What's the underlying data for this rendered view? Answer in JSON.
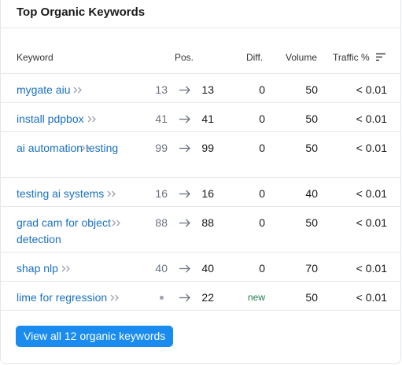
{
  "card": {
    "title": "Top Organic Keywords"
  },
  "table": {
    "headers": {
      "keyword": "Keyword",
      "pos": "Pos.",
      "diff": "Diff.",
      "volume": "Volume",
      "traffic": "Traffic %"
    },
    "rows": [
      {
        "keyword": "mygate aiu",
        "prev_pos": "13",
        "pos": "13",
        "diff": "0",
        "volume": "50",
        "traffic": "< 0.01"
      },
      {
        "keyword": "install pdpbox",
        "prev_pos": "41",
        "pos": "41",
        "diff": "0",
        "volume": "50",
        "traffic": "< 0.01"
      },
      {
        "keyword": "ai automation testing",
        "prev_pos": "99",
        "pos": "99",
        "diff": "0",
        "volume": "50",
        "traffic": "< 0.01"
      },
      {
        "keyword": "testing ai systems",
        "prev_pos": "16",
        "pos": "16",
        "diff": "0",
        "volume": "40",
        "traffic": "< 0.01"
      },
      {
        "keyword": "grad cam for object detection",
        "prev_pos": "88",
        "pos": "88",
        "diff": "0",
        "volume": "50",
        "traffic": "< 0.01"
      },
      {
        "keyword": "shap nlp",
        "prev_pos": "40",
        "pos": "40",
        "diff": "0",
        "volume": "70",
        "traffic": "< 0.01"
      },
      {
        "keyword": "lime for regression",
        "prev_pos": "",
        "pos": "22",
        "diff": "new",
        "volume": "50",
        "traffic": "< 0.01"
      }
    ]
  },
  "footer": {
    "view_all_label": "View all 12 organic keywords"
  },
  "icons": {
    "sort": "sort-lines-icon",
    "keyword_link": "double-chevron-right-icon",
    "position_change": "arrow-right-icon",
    "no_previous_position": "dot-icon"
  },
  "colors": {
    "link": "#1a70c2",
    "button": "#1a8cf0",
    "new_badge": "#1f7a4f"
  }
}
